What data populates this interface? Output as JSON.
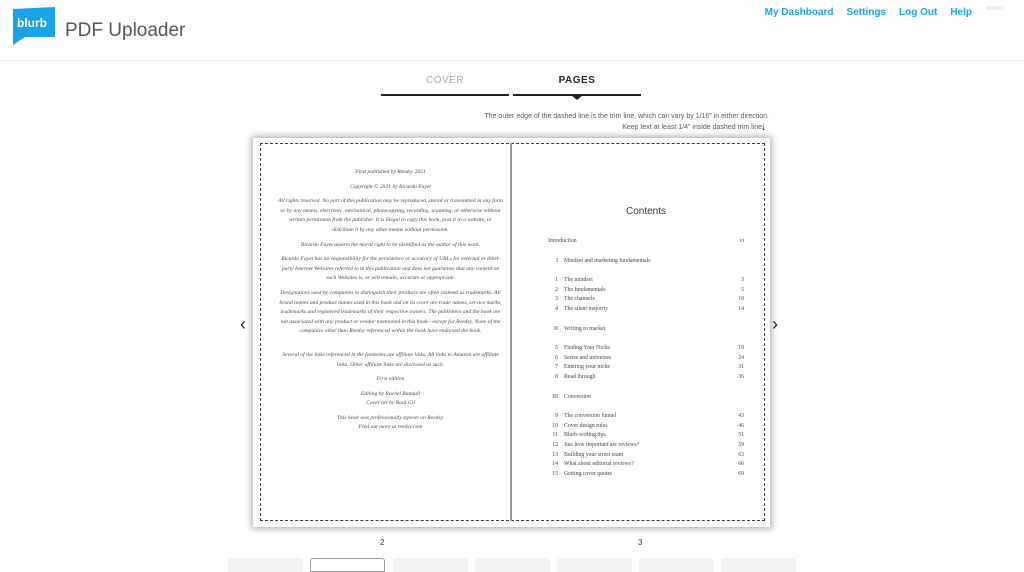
{
  "header": {
    "logo_text": "blurb",
    "title": "PDF Uploader",
    "brand_color": "#1aa3e8",
    "nav": [
      "My Dashboard",
      "Settings",
      "Log Out",
      "Help"
    ]
  },
  "tabs": [
    {
      "label": "COVER",
      "active": false
    },
    {
      "label": "PAGES",
      "active": true
    }
  ],
  "hints": [
    "The outer edge of the dashed line is the trim line, which can vary by 1/16\" in either direction.",
    "Keep text at least 1/4\" inside dashed trim line."
  ],
  "left_page": {
    "number": "2",
    "paragraphs": [
      "First published by Reedsy 2021",
      "Copyright © 2021 by Ricardo Fayet",
      "All rights reserved. No part of this publication may be reproduced, stored or transmitted in any form or by any means, electronic, mechanical, photocopying, recording, scanning, or otherwise without written permission from the publisher. It is illegal to copy this book, post it to a website, or distribute it by any other means without permission.",
      "Ricardo Fayet asserts the moral right to be identified as the author of this work.",
      "Ricardo Fayet has no responsibility for the persistence or accuracy of URLs for external or third-party Internet Websites referred to in this publication and does not guarantee that any content on such Websites is, or will remain, accurate or appropriate.",
      "Designations used by companies to distinguish their products are often claimed as trademarks. All brand names and product names used in this book and on its cover are trade names, service marks, trademarks and registered trademarks of their respective owners. The publishers and the book are not associated with any product or vendor mentioned in this book—except for Reedsy. None of the companies other than Reedsy referenced within the book have endorsed the book.",
      "Several of the links referenced in the footnotes are affiliate links. All links to Amazon are affiliate links. Other affiliate links are disclosed as such.",
      "First edition",
      "Editing by Rachel Randall\nCover art by Raúl Gil",
      "This book was professionally typeset on Reedsy.\nFind out more at reedsy.com"
    ]
  },
  "right_page": {
    "number": "3",
    "heading": "Contents",
    "entries": [
      {
        "n": "",
        "t": "Introduction",
        "p": "vi"
      },
      {
        "gap": true
      },
      {
        "n": "I",
        "t": "Mindset and marketing fundamentals",
        "p": ""
      },
      {
        "gap": true
      },
      {
        "n": "1",
        "t": "The mindset",
        "p": "3"
      },
      {
        "n": "2",
        "t": "The fundamentals",
        "p": "5"
      },
      {
        "n": "3",
        "t": "The channels",
        "p": "10"
      },
      {
        "n": "4",
        "t": "The silent majority",
        "p": "14"
      },
      {
        "gap": true
      },
      {
        "n": "II",
        "t": "Writing to market",
        "p": ""
      },
      {
        "gap": true
      },
      {
        "n": "5",
        "t": "Finding Your Niche",
        "p": "19"
      },
      {
        "n": "6",
        "t": "Series and universes",
        "p": "24"
      },
      {
        "n": "7",
        "t": "Entering your niche",
        "p": "31"
      },
      {
        "n": "8",
        "t": "Read through",
        "p": "36"
      },
      {
        "gap": true
      },
      {
        "n": "III",
        "t": "Conversion",
        "p": ""
      },
      {
        "gap": true
      },
      {
        "n": "9",
        "t": "The conversion funnel",
        "p": "43"
      },
      {
        "n": "10",
        "t": "Cover design rules",
        "p": "46"
      },
      {
        "n": "11",
        "t": "Blurb-writing tips",
        "p": "51"
      },
      {
        "n": "12",
        "t": "Just how important are reviews?",
        "p": "59"
      },
      {
        "n": "13",
        "t": "Building your street team",
        "p": "63"
      },
      {
        "n": "14",
        "t": "What about editorial reviews?",
        "p": "66"
      },
      {
        "n": "15",
        "t": "Getting cover quotes",
        "p": "69"
      }
    ]
  },
  "pager": {
    "prev_icon": "chevron-left-icon",
    "next_icon": "chevron-right-icon",
    "prev": "‹",
    "next": "›"
  }
}
